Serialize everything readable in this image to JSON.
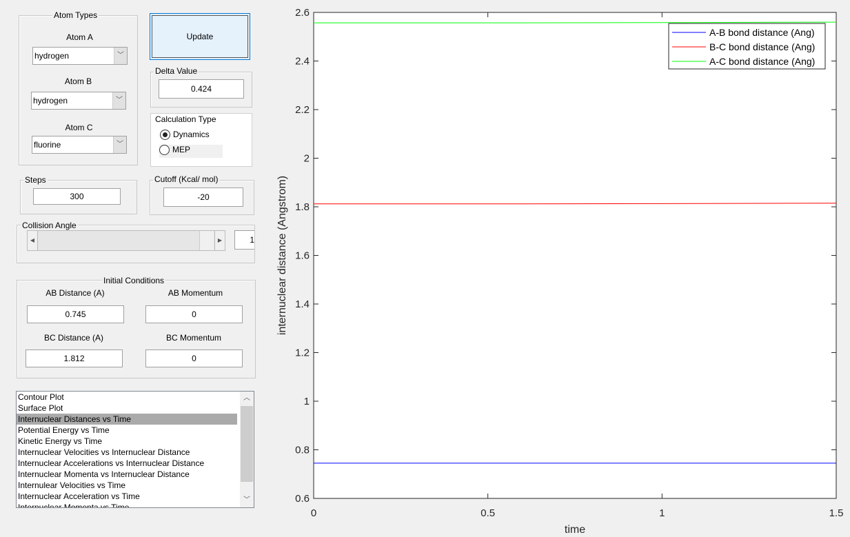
{
  "atom_types": {
    "title": "Atom Types",
    "atom_a_label": "Atom A",
    "atom_a": "hydrogen",
    "atom_b_label": "Atom B",
    "atom_b": "hydrogen",
    "atom_c_label": "Atom C",
    "atom_c": "fluorine"
  },
  "update_label": "Update",
  "delta": {
    "title": "Delta Value",
    "value": "0.424"
  },
  "calc_type": {
    "title": "Calculation Type",
    "options": [
      "Dynamics",
      "MEP"
    ],
    "selected": "Dynamics"
  },
  "steps": {
    "title": "Steps",
    "value": "300"
  },
  "cutoff": {
    "title": "Cutoff (Kcal/ mol)",
    "value": "-20"
  },
  "collision": {
    "title": "Collision Angle",
    "value": "1",
    "slider_fraction": 0.0
  },
  "initial": {
    "title": "Initial Conditions",
    "ab_dist_label": "AB Distance (A)",
    "ab_dist": "0.745",
    "ab_mom_label": "AB Momentum",
    "ab_mom": "0",
    "bc_dist_label": "BC Distance (A)",
    "bc_dist": "1.812",
    "bc_mom_label": "BC Momentum",
    "bc_mom": "0"
  },
  "plot_list": {
    "items": [
      "Contour Plot",
      "Surface Plot",
      "Internuclear Distances vs Time",
      "Potential Energy vs Time",
      "Kinetic Energy vs Time",
      "Internuclear Velocities vs Internuclear Distance",
      "Internuclear Accelerations vs Internuclear Distance",
      "Internuclear Momenta vs Internuclear Distance",
      "Internulear Velocities vs Time",
      "Internuclear Acceleration vs Time",
      "Internuclear Momenta vs Time"
    ],
    "selected_index": 2
  },
  "chart_data": {
    "type": "line",
    "xlabel": "time",
    "ylabel": "internuclear distance (Angstrom)",
    "xlim": [
      0,
      1.5
    ],
    "ylim": [
      0.6,
      2.6
    ],
    "xticks": [
      "0",
      "0.5",
      "1",
      "1.5"
    ],
    "yticks": [
      "0.6",
      "0.8",
      "1",
      "1.2",
      "1.4",
      "1.6",
      "1.8",
      "2",
      "2.2",
      "2.4",
      "2.6"
    ],
    "legend_position": "top-right",
    "grid": false,
    "x": [
      0,
      0.5,
      1,
      1.5
    ],
    "series": [
      {
        "name": "A-B bond distance (Ang)",
        "color": "#0000ff",
        "values": [
          0.745,
          0.745,
          0.745,
          0.745
        ]
      },
      {
        "name": "B-C bond distance (Ang)",
        "color": "#ff0000",
        "values": [
          1.812,
          1.812,
          1.813,
          1.815
        ]
      },
      {
        "name": "A-C bond distance (Ang)",
        "color": "#00ff00",
        "values": [
          2.557,
          2.557,
          2.558,
          2.56
        ]
      }
    ]
  }
}
